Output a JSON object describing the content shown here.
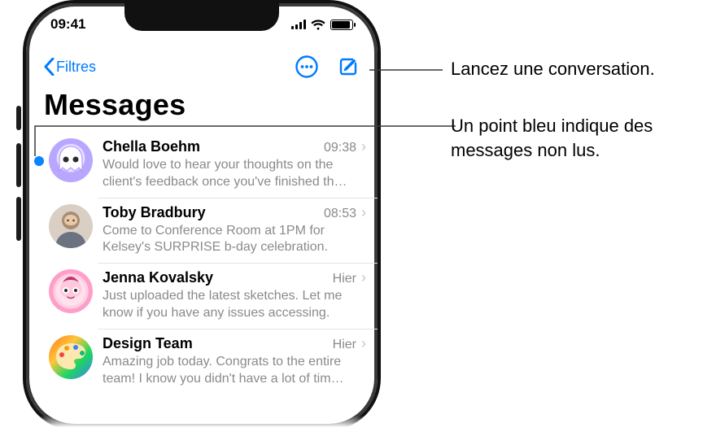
{
  "status": {
    "time": "09:41"
  },
  "nav": {
    "back_label": "Filtres",
    "more_label": "Plus",
    "compose_label": "Rédiger"
  },
  "title": "Messages",
  "conversations": [
    {
      "name": "Chella Boehm",
      "time": "09:38",
      "preview": "Would love to hear your thoughts on the client's feedback once you've finished th…",
      "unread": true,
      "avatar_kind": "memoji-ghost"
    },
    {
      "name": "Toby Bradbury",
      "time": "08:53",
      "preview": "Come to Conference Room at 1PM for Kelsey's SURPRISE b-day celebration.",
      "unread": false,
      "avatar_kind": "photo"
    },
    {
      "name": "Jenna Kovalsky",
      "time": "Hier",
      "preview": "Just uploaded the latest sketches. Let me know if you have any issues accessing.",
      "unread": false,
      "avatar_kind": "memoji-face"
    },
    {
      "name": "Design Team",
      "time": "Hier",
      "preview": "Amazing job today. Congrats to the entire team! I know you didn't have a lot of tim…",
      "unread": false,
      "avatar_kind": "palette"
    }
  ],
  "callouts": {
    "compose": "Lancez une conversation.",
    "unread": "Un point bleu indique des messages non lus."
  }
}
